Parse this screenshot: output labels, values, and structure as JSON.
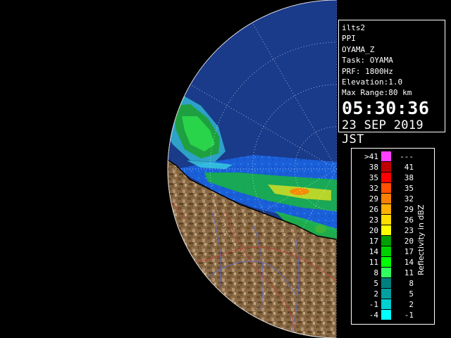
{
  "radar_info": {
    "product": "ilts2",
    "mode": "PPI",
    "site": "OYAMA_Z",
    "task": "Task: OYAMA",
    "prf": "PRF: 1800Hz",
    "elevation": "Elevation:1.0",
    "max_range": "Max Range:80 km",
    "time": "05:30:36",
    "date": "23 SEP 2019 JST"
  },
  "legend": {
    "unit": "Reflectivity in dBZ",
    "rows": [
      {
        "lo": ">41",
        "hi": "---",
        "color": "#ff40ff"
      },
      {
        "lo": "38",
        "hi": "41",
        "color": "#c00000"
      },
      {
        "lo": "35",
        "hi": "38",
        "color": "#ff0000"
      },
      {
        "lo": "32",
        "hi": "35",
        "color": "#ff5000"
      },
      {
        "lo": "29",
        "hi": "32",
        "color": "#ff8000"
      },
      {
        "lo": "26",
        "hi": "29",
        "color": "#ffb000"
      },
      {
        "lo": "23",
        "hi": "26",
        "color": "#ffdd00"
      },
      {
        "lo": "20",
        "hi": "23",
        "color": "#ffff00"
      },
      {
        "lo": "17",
        "hi": "20",
        "color": "#00a000"
      },
      {
        "lo": "14",
        "hi": "17",
        "color": "#00d000"
      },
      {
        "lo": "11",
        "hi": "14",
        "color": "#00ff00"
      },
      {
        "lo": "8",
        "hi": "11",
        "color": "#30ff60"
      },
      {
        "lo": "5",
        "hi": "8",
        "color": "#008080"
      },
      {
        "lo": "2",
        "hi": "5",
        "color": "#00a0a0"
      },
      {
        "lo": "-1",
        "hi": "2",
        "color": "#00d0d0"
      },
      {
        "lo": "-4",
        "hi": "-1",
        "color": "#00ffff"
      }
    ]
  },
  "colors": {
    "sea_echo": "#1e6fe0",
    "clear_air": "#1a3a8a",
    "land": "#8a6a44",
    "rivers": "#5a6ad0",
    "boundaries": "#c04040",
    "coastline": "#000000",
    "range_rings": "#ffffff"
  }
}
